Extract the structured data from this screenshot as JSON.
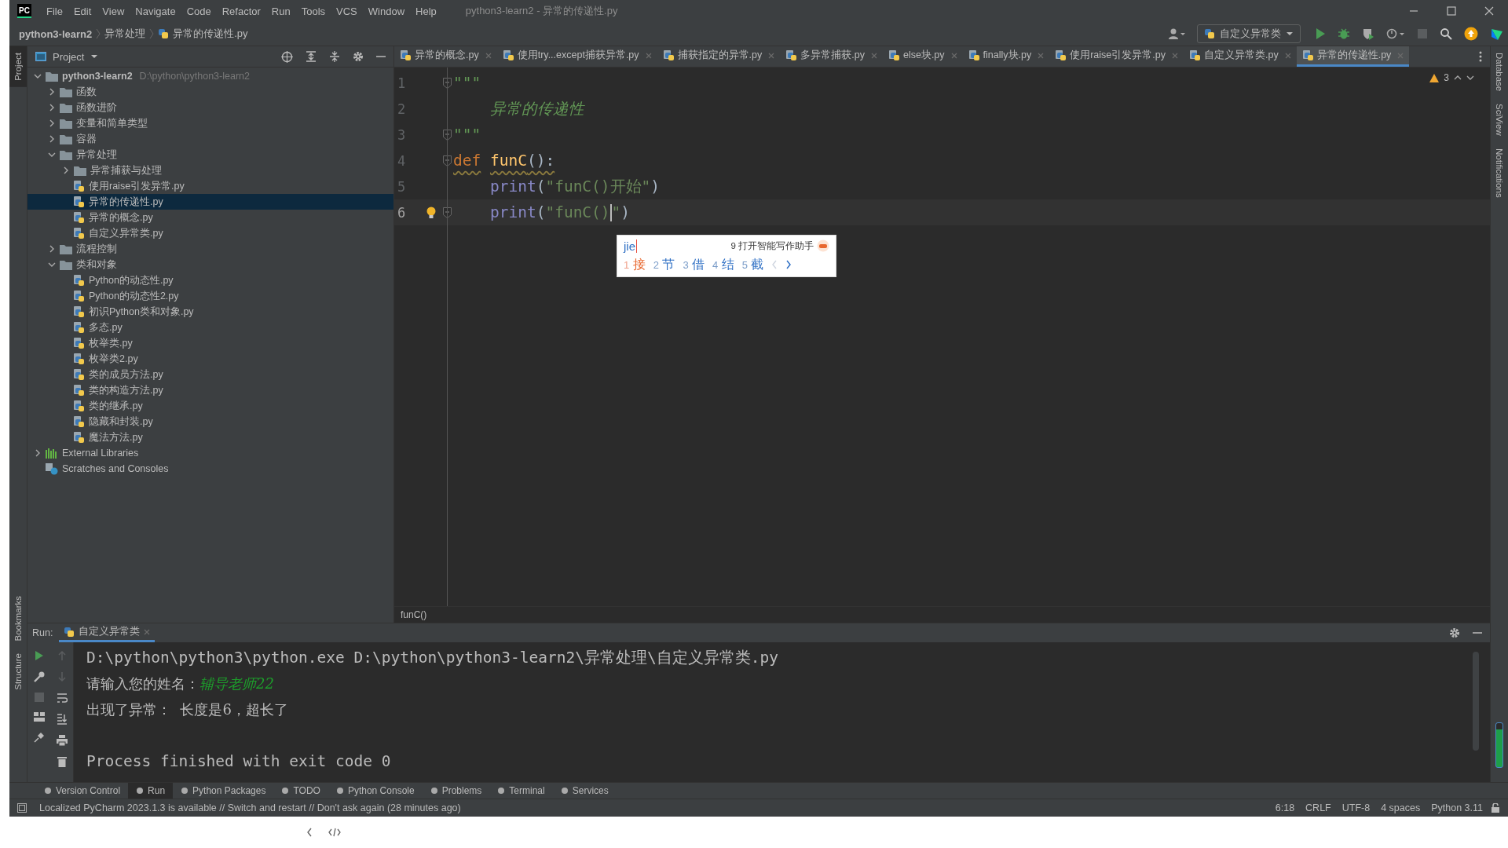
{
  "window": {
    "logo": "PC",
    "menu": [
      "File",
      "Edit",
      "View",
      "Navigate",
      "Code",
      "Refactor",
      "Run",
      "Tools",
      "VCS",
      "Window",
      "Help"
    ],
    "title": "python3-learn2 - 异常的传递性.py"
  },
  "breadcrumb": [
    "python3-learn2",
    "异常处理",
    "异常的传递性.py"
  ],
  "toolbar": {
    "run_config": "自定义异常类"
  },
  "side_left": [
    "Project",
    "Bookmarks",
    "Structure"
  ],
  "side_right": [
    "Database",
    "SciView",
    "Notifications"
  ],
  "project": {
    "title": "Project",
    "tree": [
      {
        "kind": "root",
        "label": "python3-learn2",
        "hint": "D:\\python\\python3-learn2",
        "expanded": true,
        "selected": false,
        "children": [
          {
            "kind": "folder",
            "label": "函数",
            "expanded": false,
            "selected": false
          },
          {
            "kind": "folder",
            "label": "函数进阶",
            "expanded": false,
            "selected": false
          },
          {
            "kind": "folder",
            "label": "变量和简单类型",
            "expanded": false,
            "selected": false
          },
          {
            "kind": "folder",
            "label": "容器",
            "expanded": false,
            "selected": false
          },
          {
            "kind": "folder",
            "label": "异常处理",
            "expanded": true,
            "selected": false,
            "children": [
              {
                "kind": "folder",
                "label": "异常捕获与处理",
                "expanded": false,
                "selected": false
              },
              {
                "kind": "file",
                "label": "使用raise引发异常.py",
                "selected": false
              },
              {
                "kind": "file",
                "label": "异常的传递性.py",
                "selected": true
              },
              {
                "kind": "file",
                "label": "异常的概念.py",
                "selected": false
              },
              {
                "kind": "file",
                "label": "自定义异常类.py",
                "selected": false
              }
            ]
          },
          {
            "kind": "folder",
            "label": "流程控制",
            "expanded": false,
            "selected": false
          },
          {
            "kind": "folder",
            "label": "类和对象",
            "expanded": true,
            "selected": false,
            "children": [
              {
                "kind": "file",
                "label": "Python的动态性.py",
                "selected": false
              },
              {
                "kind": "file",
                "label": "Python的动态性2.py",
                "selected": false
              },
              {
                "kind": "file",
                "label": "初识Python类和对象.py",
                "selected": false
              },
              {
                "kind": "file",
                "label": "多态.py",
                "selected": false
              },
              {
                "kind": "file",
                "label": "枚举类.py",
                "selected": false
              },
              {
                "kind": "file",
                "label": "枚举类2.py",
                "selected": false
              },
              {
                "kind": "file",
                "label": "类的成员方法.py",
                "selected": false
              },
              {
                "kind": "file",
                "label": "类的构造方法.py",
                "selected": false
              },
              {
                "kind": "file",
                "label": "类的继承.py",
                "selected": false
              },
              {
                "kind": "file",
                "label": "隐藏和封装.py",
                "selected": false
              },
              {
                "kind": "file",
                "label": "魔法方法.py",
                "selected": false
              }
            ]
          }
        ]
      },
      {
        "kind": "libraries",
        "label": "External Libraries",
        "expanded": false,
        "selected": false
      },
      {
        "kind": "scratches",
        "label": "Scratches and Consoles",
        "selected": false
      }
    ]
  },
  "tabs": [
    {
      "label": "异常的概念.py",
      "selected": false
    },
    {
      "label": "使用try...except捕获异常.py",
      "selected": false
    },
    {
      "label": "捕获指定的异常.py",
      "selected": false
    },
    {
      "label": "多异常捕获.py",
      "selected": false
    },
    {
      "label": "else块.py",
      "selected": false
    },
    {
      "label": "finally块.py",
      "selected": false
    },
    {
      "label": "使用raise引发异常.py",
      "selected": false
    },
    {
      "label": "自定义异常类.py",
      "selected": false
    },
    {
      "label": "异常的传递性.py",
      "selected": true
    }
  ],
  "editor": {
    "warnings": "3",
    "lines": [
      {
        "number": "1",
        "fold": true,
        "current": false,
        "bulb": false,
        "squiggle": false,
        "tokens": [
          {
            "kind": "doc",
            "text": "\"\"\""
          }
        ]
      },
      {
        "number": "2",
        "fold": false,
        "current": false,
        "bulb": false,
        "squiggle": false,
        "tokens": [
          {
            "kind": "doc",
            "text": "    异常的传递性"
          }
        ]
      },
      {
        "number": "3",
        "fold": true,
        "current": false,
        "bulb": false,
        "squiggle": false,
        "tokens": [
          {
            "kind": "doc",
            "text": "\"\"\""
          }
        ]
      },
      {
        "number": "4",
        "fold": true,
        "current": false,
        "bulb": false,
        "squiggle": true,
        "tokens": [
          {
            "kind": "keyword",
            "text": "def"
          },
          {
            "kind": "function",
            "text": "funC"
          },
          {
            "kind": "plain",
            "text": "():"
          }
        ]
      },
      {
        "number": "5",
        "fold": false,
        "current": false,
        "bulb": false,
        "squiggle": false,
        "tokens": [
          {
            "kind": "indent"
          },
          {
            "kind": "builtin",
            "text": "print"
          },
          {
            "kind": "plain",
            "text": "("
          },
          {
            "kind": "string",
            "text": "\"funC()开始\""
          },
          {
            "kind": "plain",
            "text": ")"
          }
        ]
      },
      {
        "number": "6",
        "fold": true,
        "current": true,
        "bulb": true,
        "squiggle": false,
        "tokens": [
          {
            "kind": "indent"
          },
          {
            "kind": "builtin",
            "text": "print"
          },
          {
            "kind": "plain",
            "text": "("
          },
          {
            "kind": "string",
            "text": "\"funC()"
          },
          {
            "kind": "caret"
          },
          {
            "kind": "string",
            "text": "\""
          },
          {
            "kind": "plain",
            "text": ")"
          }
        ]
      }
    ],
    "crumb": "funC()"
  },
  "ime": {
    "input": "jie",
    "hint": "9 打开智能写作助手",
    "candidates": [
      {
        "num": "1",
        "char": "接",
        "selected": true
      },
      {
        "num": "2",
        "char": "节",
        "selected": false
      },
      {
        "num": "3",
        "char": "借",
        "selected": false
      },
      {
        "num": "4",
        "char": "结",
        "selected": false
      },
      {
        "num": "5",
        "char": "截",
        "selected": false
      }
    ]
  },
  "run": {
    "label": "Run:",
    "tab": "自定义异常类",
    "output": [
      {
        "kind": "command",
        "text": "D:\\python\\python3\\python.exe D:\\python\\python3-learn2\\异常处理\\自定义异常类.py"
      },
      {
        "kind": "prompt",
        "text": "请输入您的姓名：",
        "input": "辅导老师22"
      },
      {
        "kind": "message",
        "text": "出现了异常：  长度是6，超长了"
      },
      {
        "kind": "blank"
      },
      {
        "kind": "command",
        "text": "Process finished with exit code 0"
      }
    ]
  },
  "tool_tabs": [
    {
      "label": "Version Control",
      "selected": false
    },
    {
      "label": "Run",
      "selected": true
    },
    {
      "label": "Python Packages",
      "selected": false
    },
    {
      "label": "TODO",
      "selected": false
    },
    {
      "label": "Python Console",
      "selected": false
    },
    {
      "label": "Problems",
      "selected": false
    },
    {
      "label": "Terminal",
      "selected": false
    },
    {
      "label": "Services",
      "selected": false
    }
  ],
  "status": {
    "message": "Localized PyCharm 2023.1.3 is available // Switch and restart // Don't ask again (28 minutes ago)",
    "items": [
      "6:18",
      "CRLF",
      "UTF-8",
      "4 spaces",
      "Python 3.11"
    ]
  }
}
